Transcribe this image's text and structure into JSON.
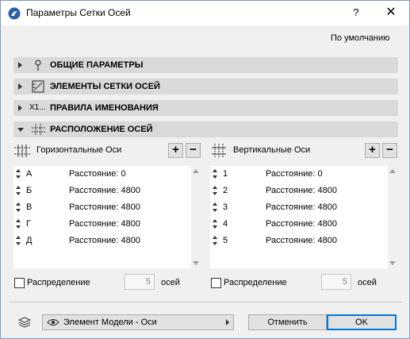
{
  "window": {
    "title": "Параметры Сетки Осей",
    "help": "?",
    "close": "✕"
  },
  "default_link": "По умолчанию",
  "sections": [
    {
      "label": "ОБЩИЕ ПАРАМЕТРЫ",
      "icon": "pin-icon",
      "expanded": false
    },
    {
      "label": "ЭЛЕМЕНТЫ СЕТКИ ОСЕЙ",
      "icon": "grid-element-icon",
      "expanded": false
    },
    {
      "label": "ПРАВИЛА ИМЕНОВАНИЯ",
      "icon": "naming-icon",
      "icon_text": "X1...",
      "expanded": false
    },
    {
      "label": "РАСПОЛОЖЕНИЕ ОСЕЙ",
      "icon": "axis-layout-icon",
      "expanded": true
    }
  ],
  "horizontal": {
    "title": "Горизонтальные Оси",
    "add": "+",
    "remove": "−",
    "rows": [
      {
        "name": "А",
        "dist": "Расстояние: 0"
      },
      {
        "name": "Б",
        "dist": "Расстояние: 4800"
      },
      {
        "name": "В",
        "dist": "Расстояние: 4800"
      },
      {
        "name": "Г",
        "dist": "Расстояние: 4800"
      },
      {
        "name": "Д",
        "dist": "Расстояние: 4800"
      }
    ],
    "distribute_label": "Распределение",
    "count": "5",
    "unit": "осей"
  },
  "vertical": {
    "title": "Вертикальные Оси",
    "add": "+",
    "remove": "−",
    "rows": [
      {
        "name": "1",
        "dist": "Расстояние: 0"
      },
      {
        "name": "2",
        "dist": "Расстояние: 4800"
      },
      {
        "name": "3",
        "dist": "Расстояние: 4800"
      },
      {
        "name": "4",
        "dist": "Расстояние: 4800"
      },
      {
        "name": "5",
        "dist": "Расстояние: 4800"
      }
    ],
    "distribute_label": "Распределение",
    "count": "5",
    "unit": "осей"
  },
  "footer": {
    "layer_combo": "Элемент Модели - Оси",
    "cancel": "Отменить",
    "ok": "OK"
  },
  "colors": {
    "accent": "#0078d7",
    "section_bg": "#d9d9d9",
    "app_icon": "#2b5fa8"
  }
}
